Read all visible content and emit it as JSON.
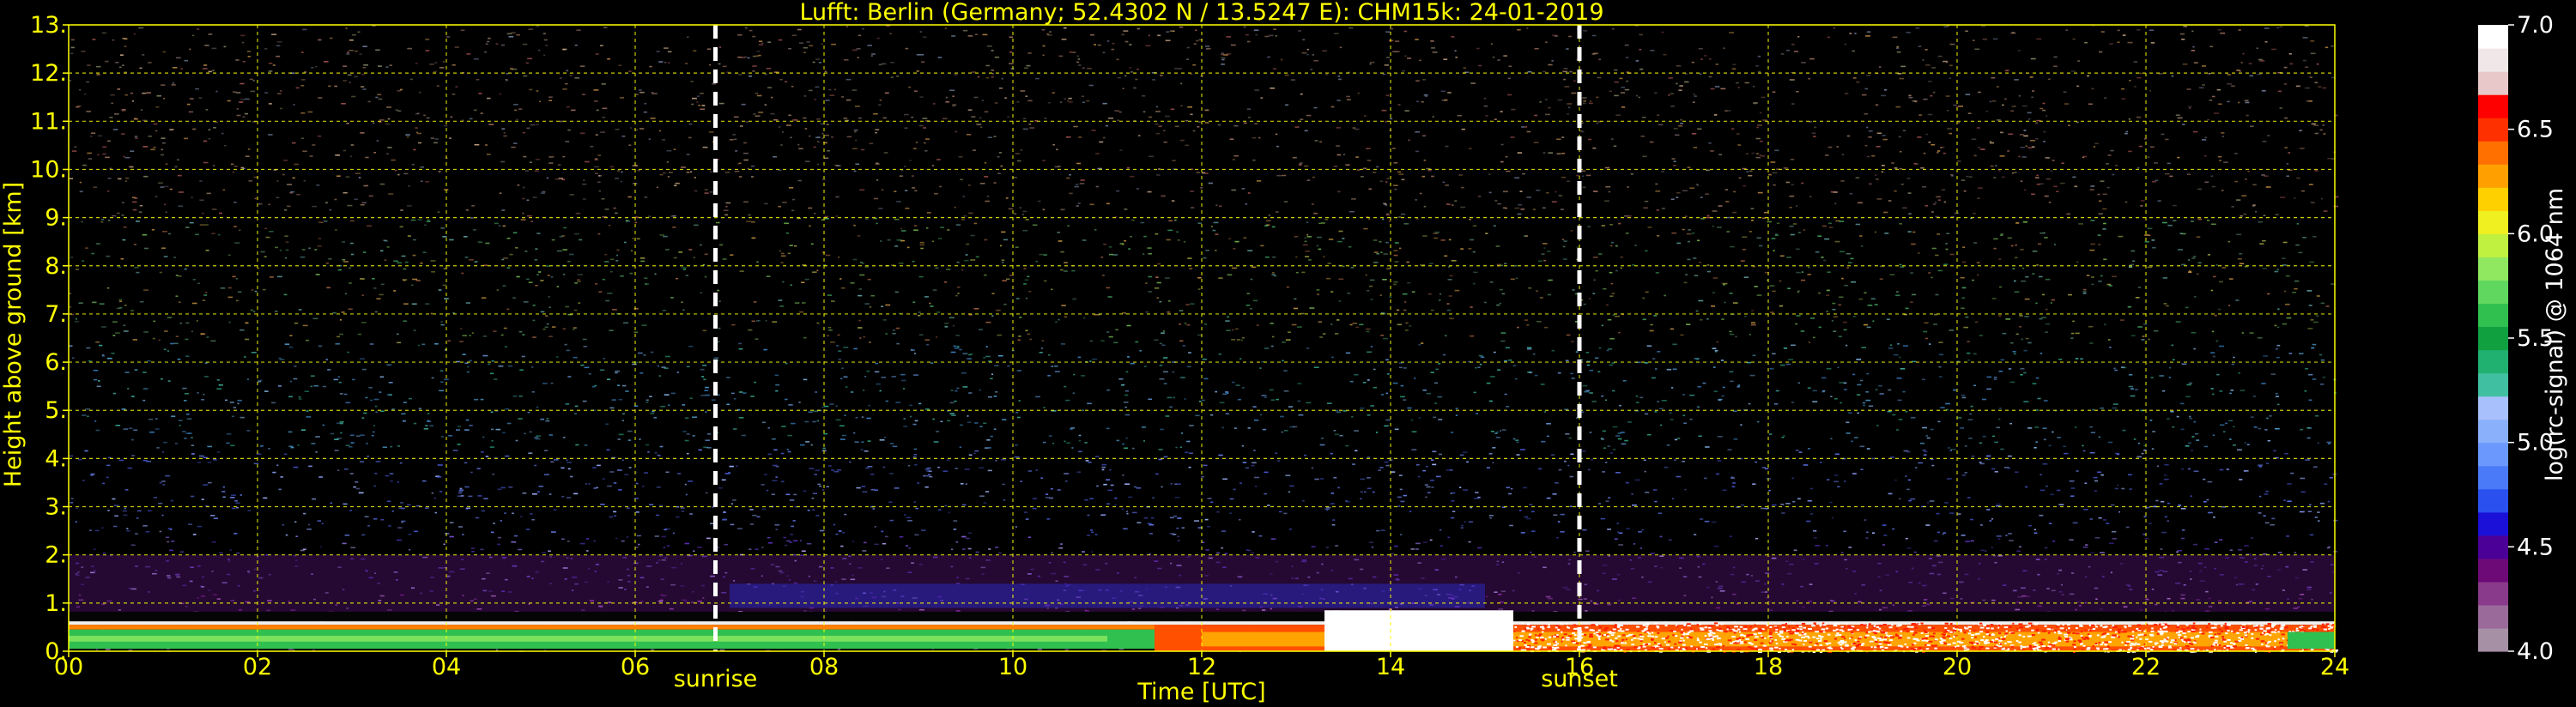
{
  "chart_data": {
    "type": "heatmap",
    "title": "Lufft: Berlin (Germany; 52.4302 N / 13.5247 E):    CHM15k: 24-01-2019",
    "xlabel": "Time [UTC]",
    "ylabel": "Height above ground [km]",
    "colorbar_label": "log(rc-signal) @ 1064 nm",
    "xlim": [
      0,
      24
    ],
    "ylim": [
      0,
      13
    ],
    "x_ticks": [
      0,
      2,
      4,
      6,
      8,
      10,
      12,
      14,
      16,
      18,
      20,
      22,
      24
    ],
    "x_tick_labels": [
      "00",
      "02",
      "04",
      "06",
      "08",
      "10",
      "12",
      "14",
      "16",
      "18",
      "20",
      "22",
      "24"
    ],
    "y_ticks": [
      0,
      1,
      2,
      3,
      4,
      5,
      6,
      7,
      8,
      9,
      10,
      11,
      12,
      13
    ],
    "y_tick_labels": [
      "0.",
      "1.",
      "2.",
      "3.",
      "4.",
      "5.",
      "6.",
      "7.",
      "8.",
      "9.",
      "10.",
      "11.",
      "12.",
      "13."
    ],
    "colorbar_range": [
      4.0,
      7.0
    ],
    "colorbar_ticks": [
      4.0,
      4.5,
      5.0,
      5.5,
      6.0,
      6.5,
      7.0
    ],
    "colorbar_tick_labels": [
      "4.0",
      "4.5",
      "5.0",
      "5.5",
      "6.0",
      "6.5",
      "7.0"
    ],
    "colormap": [
      "#a690a6",
      "#9a6a9a",
      "#8a3a8a",
      "#6e0a78",
      "#4b0098",
      "#1a10d8",
      "#2a50f0",
      "#4a7af8",
      "#6a98fc",
      "#8ab0fc",
      "#a8c0fc",
      "#40c0a0",
      "#20b070",
      "#10a040",
      "#30c050",
      "#60d860",
      "#90e860",
      "#c0f040",
      "#f0f020",
      "#ffd000",
      "#ffa000",
      "#ff7000",
      "#ff3000",
      "#ff0000",
      "#e8c8c8",
      "#f0e8e8",
      "#ffffff"
    ],
    "grid": true,
    "grid_color": "#ffff00",
    "text_color": "#ffff00",
    "background": "#000000",
    "events": [
      {
        "label": "sunrise",
        "time_utc": 6.85
      },
      {
        "label": "sunset",
        "time_utc": 16.0
      }
    ],
    "layers": [
      {
        "name": "near-ground aerosol layer",
        "height_km": [
          0.1,
          0.55
        ],
        "time_utc": [
          0,
          24
        ],
        "log_signal_range": [
          5.5,
          7.0
        ]
      },
      {
        "name": "bright low signal (white)",
        "height_km": [
          0.0,
          0.85
        ],
        "time_utc": [
          13.3,
          15.3
        ],
        "log_signal": 7.0
      },
      {
        "name": "boundary layer signal",
        "height_km": [
          0.8,
          2.0
        ],
        "time_utc": [
          0,
          24
        ],
        "log_signal_range": [
          4.3,
          4.8
        ]
      }
    ]
  }
}
